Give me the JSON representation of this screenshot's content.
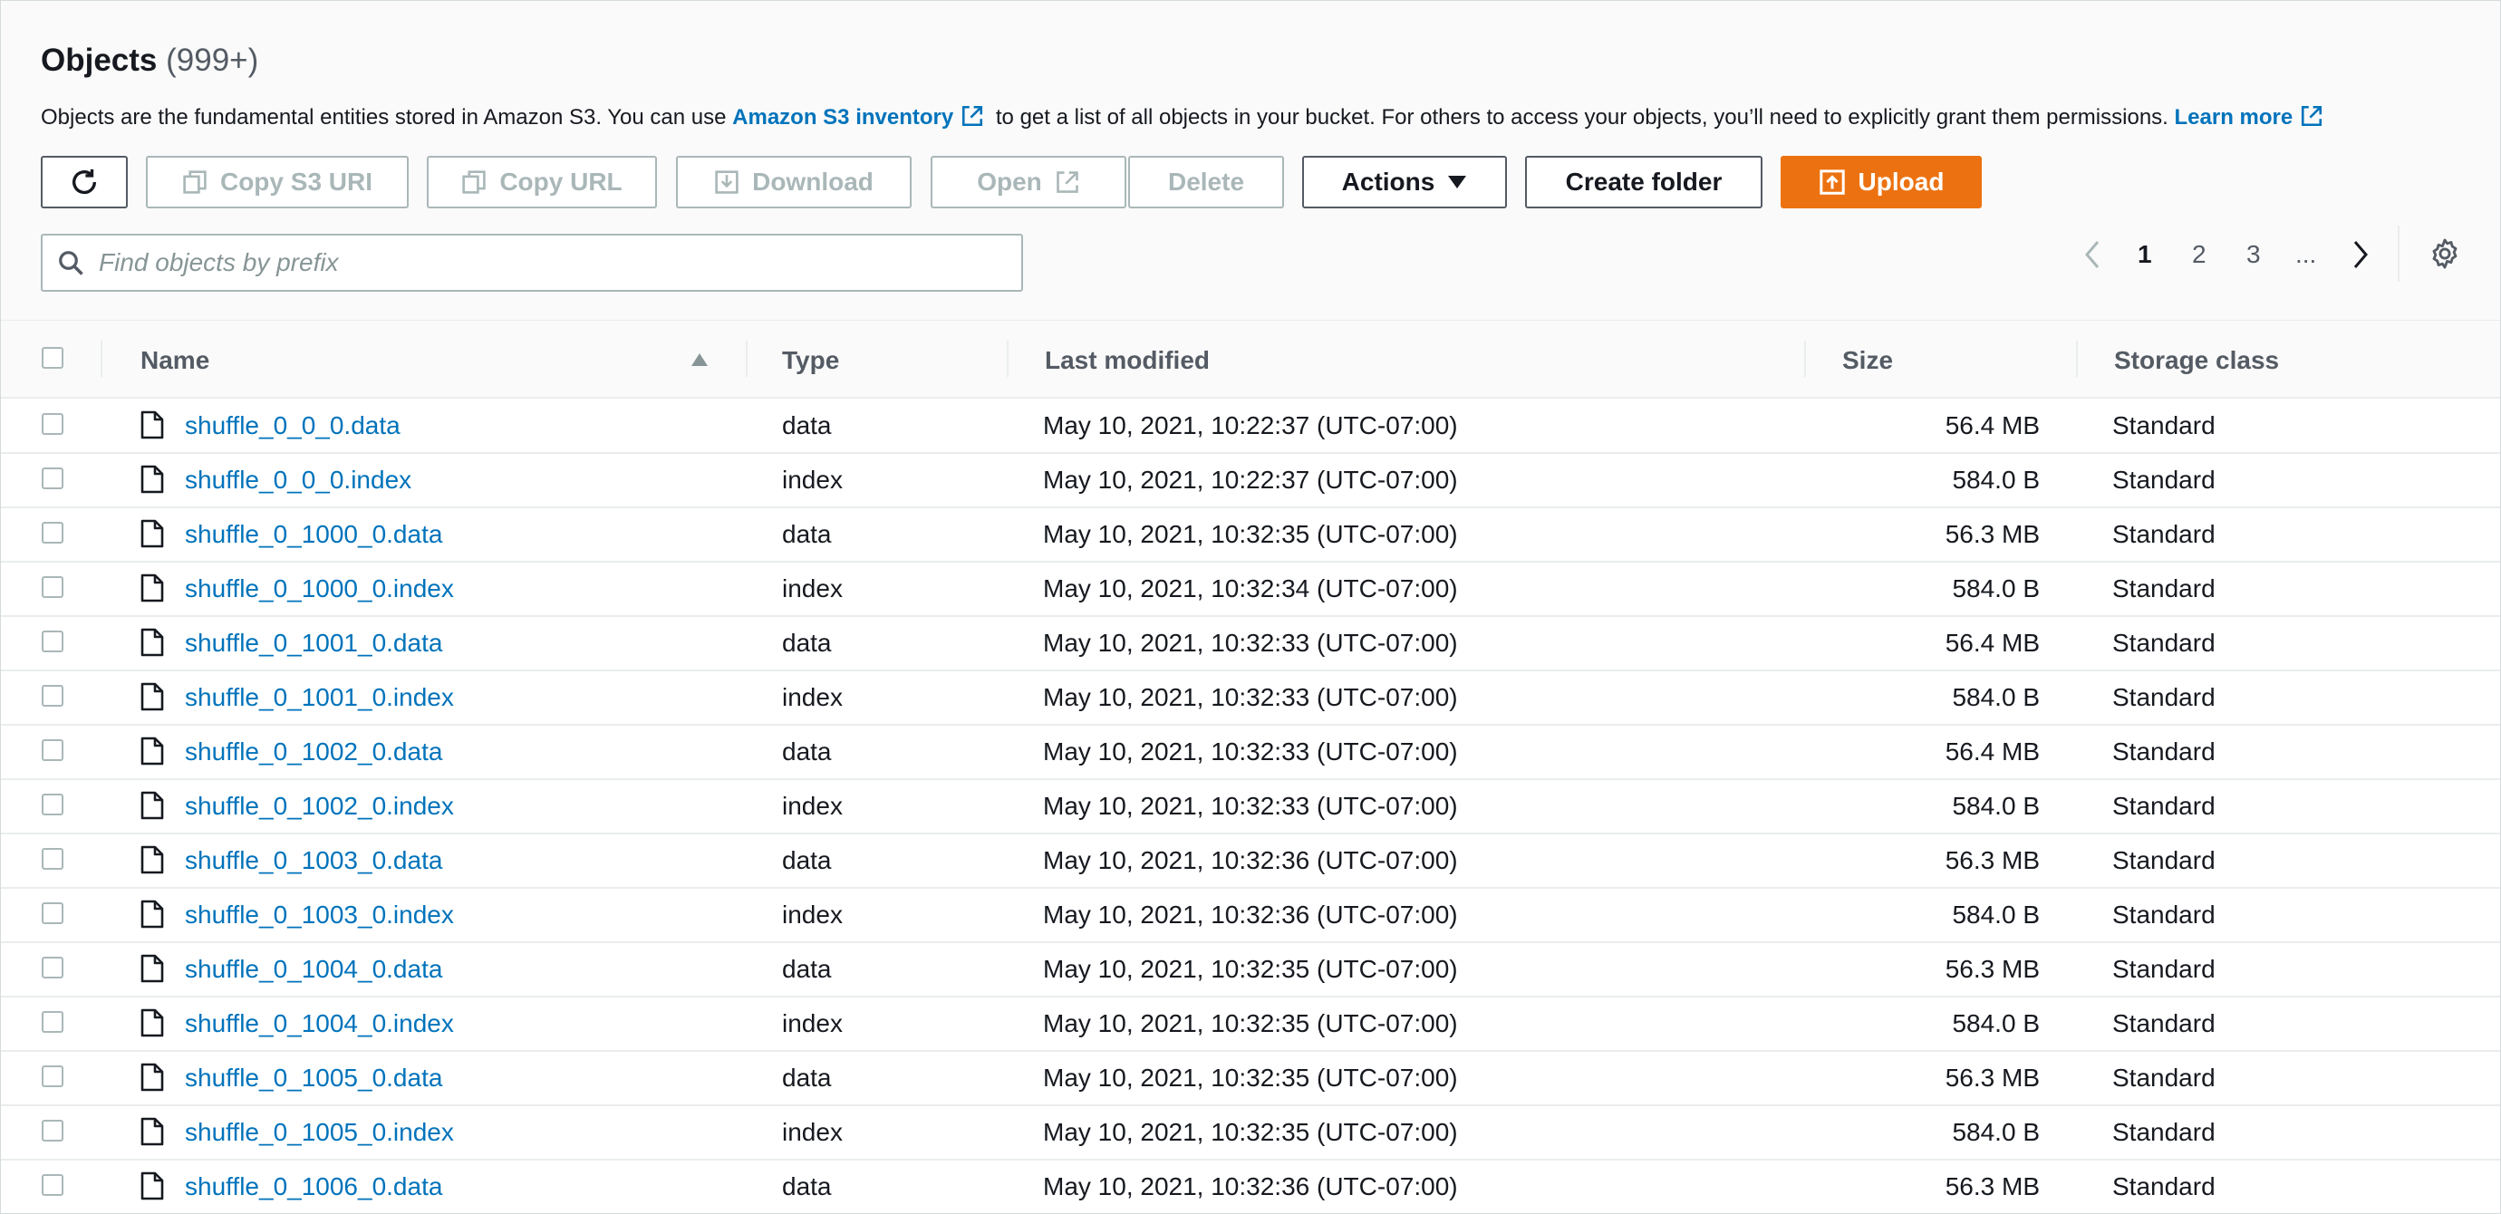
{
  "header": {
    "title": "Objects",
    "count": "(999+)",
    "desc_part1": "Objects are the fundamental entities stored in Amazon S3. You can use",
    "inventory_link": "Amazon S3 inventory",
    "desc_part2": "to get a list of all objects in your bucket. For others to access your objects, you’ll need to explicitly grant them permissions.",
    "learn_more": "Learn more"
  },
  "toolbar": {
    "copy_s3_uri": "Copy S3 URI",
    "copy_url": "Copy URL",
    "download": "Download",
    "open": "Open",
    "delete": "Delete",
    "actions": "Actions",
    "create_folder": "Create folder",
    "upload": "Upload",
    "upload_color": "#ec7211"
  },
  "search": {
    "placeholder": "Find objects by prefix",
    "value": ""
  },
  "pagination": {
    "pages": [
      "1",
      "2",
      "3"
    ],
    "current": "1",
    "ellipsis": "..."
  },
  "table": {
    "columns": {
      "name": "Name",
      "type": "Type",
      "last_modified": "Last modified",
      "size": "Size",
      "storage_class": "Storage class"
    },
    "link_color": "#0073bb",
    "rows": [
      {
        "name": "shuffle_0_0_0.data",
        "type": "data",
        "modified": "May 10, 2021, 10:22:37 (UTC-07:00)",
        "size": "56.4 MB",
        "storage": "Standard"
      },
      {
        "name": "shuffle_0_0_0.index",
        "type": "index",
        "modified": "May 10, 2021, 10:22:37 (UTC-07:00)",
        "size": "584.0 B",
        "storage": "Standard"
      },
      {
        "name": "shuffle_0_1000_0.data",
        "type": "data",
        "modified": "May 10, 2021, 10:32:35 (UTC-07:00)",
        "size": "56.3 MB",
        "storage": "Standard"
      },
      {
        "name": "shuffle_0_1000_0.index",
        "type": "index",
        "modified": "May 10, 2021, 10:32:34 (UTC-07:00)",
        "size": "584.0 B",
        "storage": "Standard"
      },
      {
        "name": "shuffle_0_1001_0.data",
        "type": "data",
        "modified": "May 10, 2021, 10:32:33 (UTC-07:00)",
        "size": "56.4 MB",
        "storage": "Standard"
      },
      {
        "name": "shuffle_0_1001_0.index",
        "type": "index",
        "modified": "May 10, 2021, 10:32:33 (UTC-07:00)",
        "size": "584.0 B",
        "storage": "Standard"
      },
      {
        "name": "shuffle_0_1002_0.data",
        "type": "data",
        "modified": "May 10, 2021, 10:32:33 (UTC-07:00)",
        "size": "56.4 MB",
        "storage": "Standard"
      },
      {
        "name": "shuffle_0_1002_0.index",
        "type": "index",
        "modified": "May 10, 2021, 10:32:33 (UTC-07:00)",
        "size": "584.0 B",
        "storage": "Standard"
      },
      {
        "name": "shuffle_0_1003_0.data",
        "type": "data",
        "modified": "May 10, 2021, 10:32:36 (UTC-07:00)",
        "size": "56.3 MB",
        "storage": "Standard"
      },
      {
        "name": "shuffle_0_1003_0.index",
        "type": "index",
        "modified": "May 10, 2021, 10:32:36 (UTC-07:00)",
        "size": "584.0 B",
        "storage": "Standard"
      },
      {
        "name": "shuffle_0_1004_0.data",
        "type": "data",
        "modified": "May 10, 2021, 10:32:35 (UTC-07:00)",
        "size": "56.3 MB",
        "storage": "Standard"
      },
      {
        "name": "shuffle_0_1004_0.index",
        "type": "index",
        "modified": "May 10, 2021, 10:32:35 (UTC-07:00)",
        "size": "584.0 B",
        "storage": "Standard"
      },
      {
        "name": "shuffle_0_1005_0.data",
        "type": "data",
        "modified": "May 10, 2021, 10:32:35 (UTC-07:00)",
        "size": "56.3 MB",
        "storage": "Standard"
      },
      {
        "name": "shuffle_0_1005_0.index",
        "type": "index",
        "modified": "May 10, 2021, 10:32:35 (UTC-07:00)",
        "size": "584.0 B",
        "storage": "Standard"
      },
      {
        "name": "shuffle_0_1006_0.data",
        "type": "data",
        "modified": "May 10, 2021, 10:32:36 (UTC-07:00)",
        "size": "56.3 MB",
        "storage": "Standard"
      }
    ]
  }
}
